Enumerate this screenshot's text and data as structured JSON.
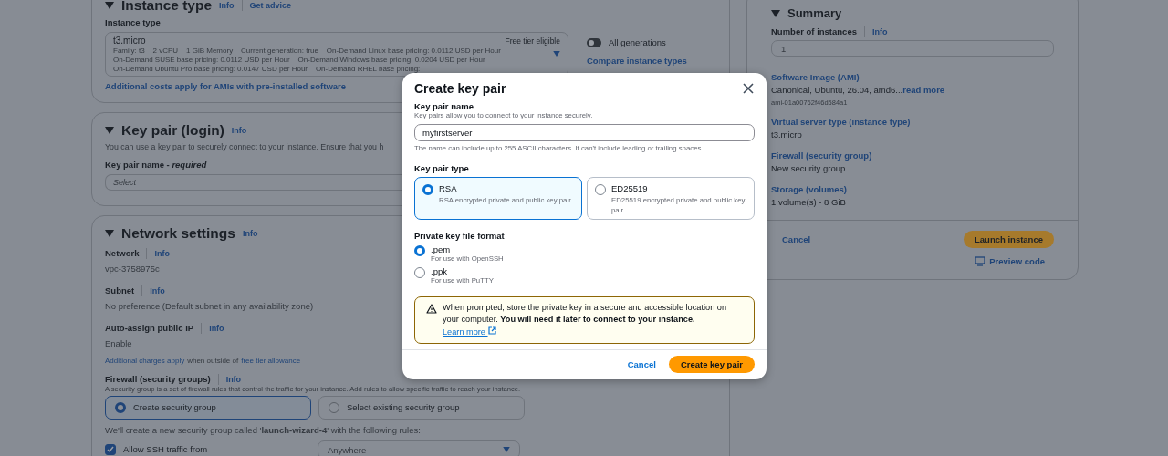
{
  "instance_type": {
    "title": "Instance type",
    "info": "Info",
    "get_advice": "Get advice",
    "field_label": "Instance type",
    "value": "t3.micro",
    "details": [
      "Family: t3    2 vCPU    1 GiB Memory    Current generation: true    On-Demand Linux base pricing: 0.0112 USD per Hour",
      "On-Demand SUSE base pricing: 0.0112 USD per Hour    On-Demand Windows base pricing: 0.0204 USD per Hour",
      "On-Demand Ubuntu Pro base pricing: 0.0147 USD per Hour    On-Demand RHEL base pricing:"
    ],
    "badge": "Free tier eligible",
    "generations_toggle": {
      "label": "All generations",
      "on": false
    },
    "compare_link": "Compare instance types",
    "costs_link": "Additional costs apply for AMIs with pre-installed software"
  },
  "key_pair": {
    "title": "Key pair (login)",
    "info": "Info",
    "description": "You can use a key pair to securely connect to your instance. Ensure that you h",
    "field_label": "Key pair name - *required*",
    "select_placeholder": "Select"
  },
  "network": {
    "title": "Network settings",
    "info": "Info",
    "fields": [
      {
        "label": "Network",
        "info": "Info",
        "value": "vpc-3758975c"
      },
      {
        "label": "Subnet",
        "info": "Info",
        "value": "No preference (Default subnet in any availability zone)"
      },
      {
        "label": "Auto-assign public IP",
        "info": "Info",
        "value": "Enable"
      }
    ],
    "charges_note": {
      "link": "Additional charges apply",
      "text": "when outside of",
      "link2": "free tier allowance"
    },
    "firewall": {
      "label": "Firewall (security groups)",
      "info": "Info",
      "description": "A security group is a set of firewall rules that control the traffic for your instance. Add rules to allow specific traffic to reach your instance.",
      "options": [
        {
          "label": "Create security group",
          "selected": true
        },
        {
          "label": "Select existing security group",
          "selected": false
        }
      ],
      "rule_note": "We'll create a new security group called '**launch-wizard-4**' with the following rules:",
      "ssh": {
        "label": "Allow SSH traffic from",
        "checked": true
      },
      "source": "Anywhere"
    }
  },
  "summary": {
    "title": "Summary",
    "instances_label": "Number of instances",
    "info": "Info",
    "instances_value": "1",
    "items": [
      {
        "label": "Software Image (AMI)",
        "value": "Canonical, Ubuntu, 26.04, amd6...",
        "link": "read more",
        "sub": "ami-01a00762f46d584a1"
      },
      {
        "label": "Virtual server type (instance type)",
        "value": "t3.micro"
      },
      {
        "label": "Firewall (security group)",
        "value": "New security group"
      },
      {
        "label": "Storage (volumes)",
        "value": "1 volume(s) - 8 GiB"
      }
    ],
    "cancel": "Cancel",
    "launch": "Launch instance",
    "preview": "Preview code"
  },
  "dialog": {
    "title": "Create key pair",
    "name_label": "Key pair name",
    "name_hint": "Key pairs allow you to connect to your instance securely.",
    "name_value": "myfirstserver",
    "name_constraint": "The name can include up to 255 ASCII characters. It can't include leading or trailing spaces.",
    "type_label": "Key pair type",
    "types": [
      {
        "label": "RSA",
        "description": "RSA encrypted private and public key pair",
        "selected": true
      },
      {
        "label": "ED25519",
        "description": "ED25519 encrypted private and public key pair",
        "selected": false
      }
    ],
    "format_label": "Private key file format",
    "formats": [
      {
        "label": ".pem",
        "description": "For use with OpenSSH",
        "selected": true
      },
      {
        "label": ".ppk",
        "description": "For use with PuTTY",
        "selected": false
      }
    ],
    "alert": {
      "text": "When prompted, store the private key in a secure and accessible location on your computer. **You will need it later to connect to your instance.**",
      "link": "Learn more"
    },
    "cancel": "Cancel",
    "create": "Create key pair"
  }
}
